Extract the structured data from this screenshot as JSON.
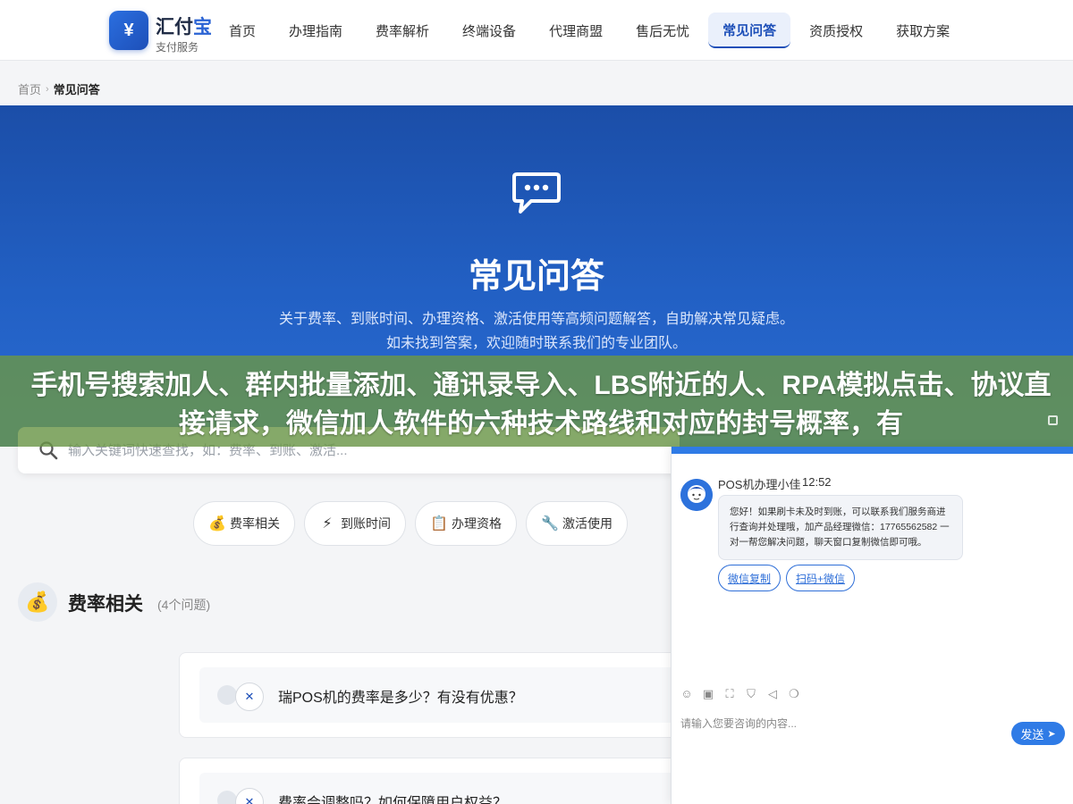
{
  "header": {
    "logo_mark": "¥",
    "logo_name_part1": "汇付",
    "logo_name_part2": "宝",
    "logo_sub": "支付服务",
    "nav": [
      {
        "label": "首页",
        "active": false
      },
      {
        "label": "办理指南",
        "active": false
      },
      {
        "label": "费率解析",
        "active": false
      },
      {
        "label": "终端设备",
        "active": false
      },
      {
        "label": "代理商盟",
        "active": false
      },
      {
        "label": "售后无忧",
        "active": false
      },
      {
        "label": "常见问答",
        "active": true
      },
      {
        "label": "资质授权",
        "active": false
      },
      {
        "label": "获取方案",
        "active": false
      }
    ]
  },
  "breadcrumb": {
    "home": "首页",
    "separator": "›",
    "current": "常见问答"
  },
  "hero": {
    "title": "常见问答",
    "desc_line1": "关于费率、到账时间、办理资格、激活使用等高频问题解答，自助解决常见疑虑。",
    "desc_line2": "如未找到答案，欢迎随时联系我们的专业团队。"
  },
  "overlay": {
    "text": "手机号搜索加人、群内批量添加、通讯录导入、LBS附近的人、RPA模拟点击、协议直接请求，微信加人软件的六种技术路线和对应的封号概率，有"
  },
  "search": {
    "placeholder": "输入关键词快速查找，如：费率、到账、激活..."
  },
  "chips": [
    {
      "icon": "💰",
      "icon_name": "money-bag-icon",
      "label": "费率相关"
    },
    {
      "icon": "⚡",
      "icon_name": "lightning-icon",
      "label": "到账时间"
    },
    {
      "icon": "📋",
      "icon_name": "clipboard-icon",
      "label": "办理资格"
    },
    {
      "icon": "🔧",
      "icon_name": "wrench-icon",
      "label": "激活使用"
    }
  ],
  "section": {
    "icon": "💰",
    "title": "费率相关",
    "count": "(4个问题)"
  },
  "faqs": [
    {
      "question": "瑞POS机的费率是多少？有没有优惠？"
    },
    {
      "question": "费率会调整吗？如何保障用户权益？"
    }
  ],
  "chat": {
    "agent_name": "POS机办理小佳",
    "time": "12:52",
    "message": "您好！如果刷卡未及时到账，可以联系我们服务商进行查询并处理哦，加产品经理微信：17765562582 一对一帮您解决问题，聊天窗口复制微信即可哦。",
    "buttons": [
      "微信复制",
      "扫码+微信"
    ],
    "input_placeholder": "请输入您要咨询的内容...",
    "send_label": "发送",
    "accent": "#2f7be6"
  }
}
